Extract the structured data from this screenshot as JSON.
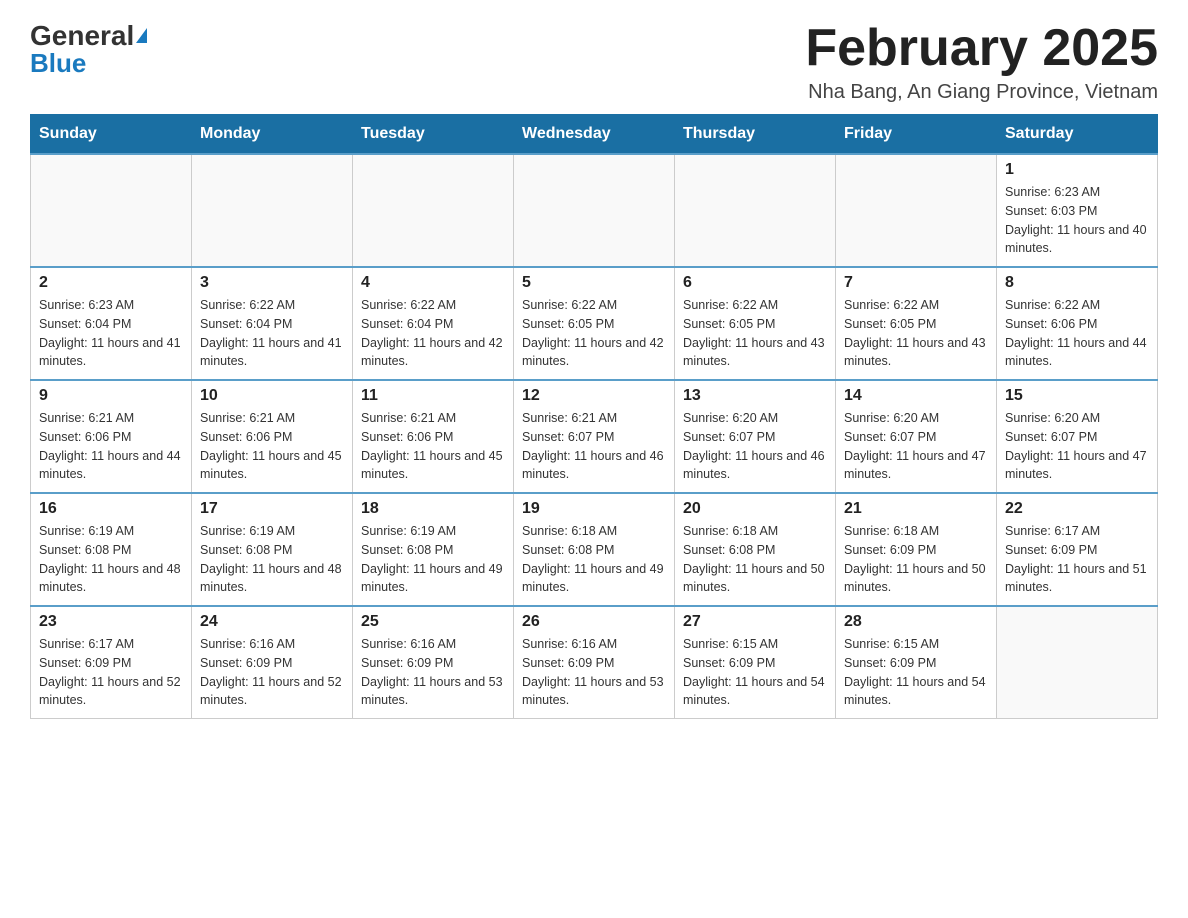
{
  "header": {
    "logo": {
      "general": "General",
      "blue": "Blue"
    },
    "title": "February 2025",
    "location": "Nha Bang, An Giang Province, Vietnam"
  },
  "days_of_week": [
    "Sunday",
    "Monday",
    "Tuesday",
    "Wednesday",
    "Thursday",
    "Friday",
    "Saturday"
  ],
  "weeks": [
    [
      {
        "day": "",
        "info": ""
      },
      {
        "day": "",
        "info": ""
      },
      {
        "day": "",
        "info": ""
      },
      {
        "day": "",
        "info": ""
      },
      {
        "day": "",
        "info": ""
      },
      {
        "day": "",
        "info": ""
      },
      {
        "day": "1",
        "info": "Sunrise: 6:23 AM\nSunset: 6:03 PM\nDaylight: 11 hours and 40 minutes."
      }
    ],
    [
      {
        "day": "2",
        "info": "Sunrise: 6:23 AM\nSunset: 6:04 PM\nDaylight: 11 hours and 41 minutes."
      },
      {
        "day": "3",
        "info": "Sunrise: 6:22 AM\nSunset: 6:04 PM\nDaylight: 11 hours and 41 minutes."
      },
      {
        "day": "4",
        "info": "Sunrise: 6:22 AM\nSunset: 6:04 PM\nDaylight: 11 hours and 42 minutes."
      },
      {
        "day": "5",
        "info": "Sunrise: 6:22 AM\nSunset: 6:05 PM\nDaylight: 11 hours and 42 minutes."
      },
      {
        "day": "6",
        "info": "Sunrise: 6:22 AM\nSunset: 6:05 PM\nDaylight: 11 hours and 43 minutes."
      },
      {
        "day": "7",
        "info": "Sunrise: 6:22 AM\nSunset: 6:05 PM\nDaylight: 11 hours and 43 minutes."
      },
      {
        "day": "8",
        "info": "Sunrise: 6:22 AM\nSunset: 6:06 PM\nDaylight: 11 hours and 44 minutes."
      }
    ],
    [
      {
        "day": "9",
        "info": "Sunrise: 6:21 AM\nSunset: 6:06 PM\nDaylight: 11 hours and 44 minutes."
      },
      {
        "day": "10",
        "info": "Sunrise: 6:21 AM\nSunset: 6:06 PM\nDaylight: 11 hours and 45 minutes."
      },
      {
        "day": "11",
        "info": "Sunrise: 6:21 AM\nSunset: 6:06 PM\nDaylight: 11 hours and 45 minutes."
      },
      {
        "day": "12",
        "info": "Sunrise: 6:21 AM\nSunset: 6:07 PM\nDaylight: 11 hours and 46 minutes."
      },
      {
        "day": "13",
        "info": "Sunrise: 6:20 AM\nSunset: 6:07 PM\nDaylight: 11 hours and 46 minutes."
      },
      {
        "day": "14",
        "info": "Sunrise: 6:20 AM\nSunset: 6:07 PM\nDaylight: 11 hours and 47 minutes."
      },
      {
        "day": "15",
        "info": "Sunrise: 6:20 AM\nSunset: 6:07 PM\nDaylight: 11 hours and 47 minutes."
      }
    ],
    [
      {
        "day": "16",
        "info": "Sunrise: 6:19 AM\nSunset: 6:08 PM\nDaylight: 11 hours and 48 minutes."
      },
      {
        "day": "17",
        "info": "Sunrise: 6:19 AM\nSunset: 6:08 PM\nDaylight: 11 hours and 48 minutes."
      },
      {
        "day": "18",
        "info": "Sunrise: 6:19 AM\nSunset: 6:08 PM\nDaylight: 11 hours and 49 minutes."
      },
      {
        "day": "19",
        "info": "Sunrise: 6:18 AM\nSunset: 6:08 PM\nDaylight: 11 hours and 49 minutes."
      },
      {
        "day": "20",
        "info": "Sunrise: 6:18 AM\nSunset: 6:08 PM\nDaylight: 11 hours and 50 minutes."
      },
      {
        "day": "21",
        "info": "Sunrise: 6:18 AM\nSunset: 6:09 PM\nDaylight: 11 hours and 50 minutes."
      },
      {
        "day": "22",
        "info": "Sunrise: 6:17 AM\nSunset: 6:09 PM\nDaylight: 11 hours and 51 minutes."
      }
    ],
    [
      {
        "day": "23",
        "info": "Sunrise: 6:17 AM\nSunset: 6:09 PM\nDaylight: 11 hours and 52 minutes."
      },
      {
        "day": "24",
        "info": "Sunrise: 6:16 AM\nSunset: 6:09 PM\nDaylight: 11 hours and 52 minutes."
      },
      {
        "day": "25",
        "info": "Sunrise: 6:16 AM\nSunset: 6:09 PM\nDaylight: 11 hours and 53 minutes."
      },
      {
        "day": "26",
        "info": "Sunrise: 6:16 AM\nSunset: 6:09 PM\nDaylight: 11 hours and 53 minutes."
      },
      {
        "day": "27",
        "info": "Sunrise: 6:15 AM\nSunset: 6:09 PM\nDaylight: 11 hours and 54 minutes."
      },
      {
        "day": "28",
        "info": "Sunrise: 6:15 AM\nSunset: 6:09 PM\nDaylight: 11 hours and 54 minutes."
      },
      {
        "day": "",
        "info": ""
      }
    ]
  ]
}
